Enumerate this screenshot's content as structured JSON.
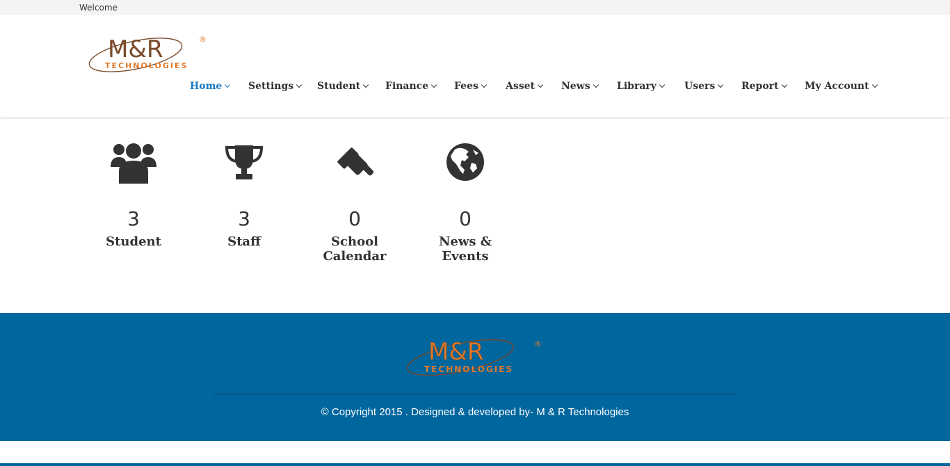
{
  "topbar": {
    "welcome": "Welcome"
  },
  "brand": {
    "logo_main": "M&R",
    "logo_sub": "TECHNOLOGIES",
    "registered": "®",
    "primary_color": "#7a4a2a",
    "accent_color": "#e07a2a"
  },
  "nav": {
    "items": [
      {
        "label": "Home",
        "active": true
      },
      {
        "label": "Settings"
      },
      {
        "label": "Student"
      },
      {
        "label": "Finance"
      },
      {
        "label": "Fees"
      },
      {
        "label": "Asset"
      },
      {
        "label": "News"
      },
      {
        "label": "Library"
      },
      {
        "label": "Users"
      },
      {
        "label": "Report"
      },
      {
        "label": "My Account"
      }
    ],
    "active_color": "#1a7ac4"
  },
  "stats": [
    {
      "icon": "users-icon",
      "value": "3",
      "label": "Student"
    },
    {
      "icon": "trophy-icon",
      "value": "3",
      "label": "Staff"
    },
    {
      "icon": "gavel-icon",
      "value": "0",
      "label": "School Calendar"
    },
    {
      "icon": "globe-icon",
      "value": "0",
      "label": "News & Events"
    }
  ],
  "footer": {
    "copyright": "© Copyright 2015 . Designed & developed by- M & R Technologies",
    "background": "#00669e"
  }
}
